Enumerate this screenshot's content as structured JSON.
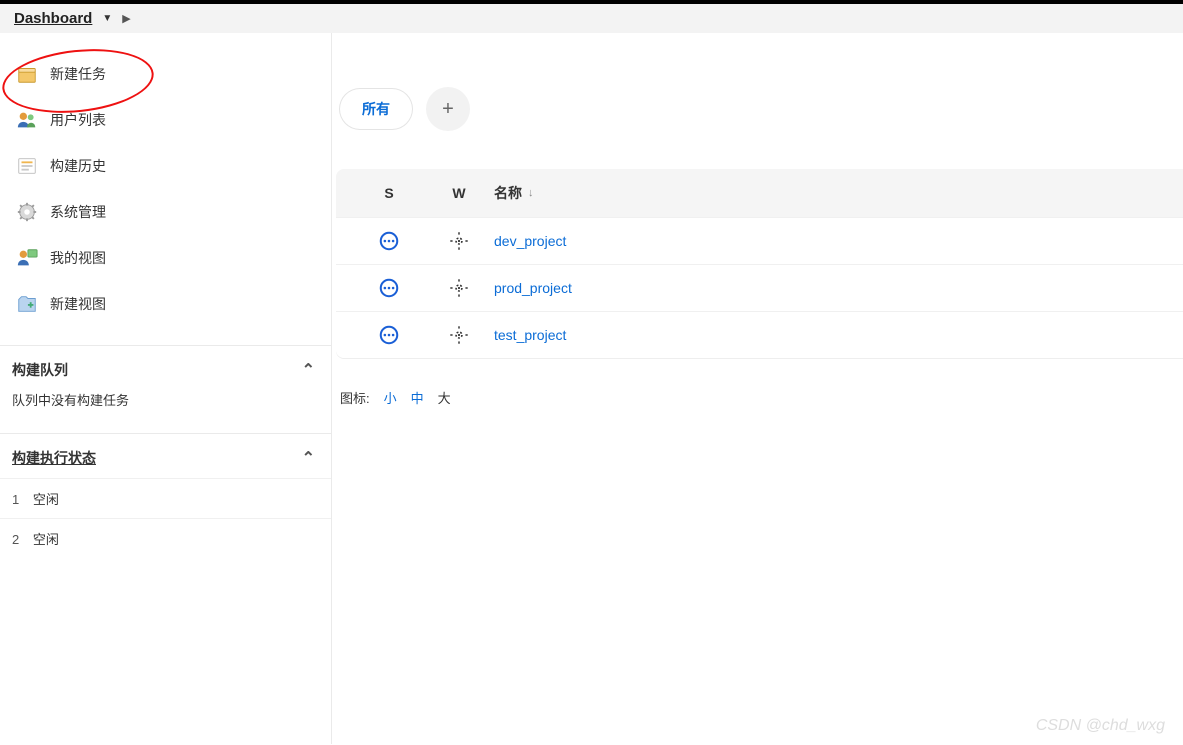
{
  "breadcrumb": {
    "title": "Dashboard"
  },
  "sidebar": {
    "items": [
      {
        "label": "新建任务",
        "icon": "box-icon"
      },
      {
        "label": "用户列表",
        "icon": "users-icon"
      },
      {
        "label": "构建历史",
        "icon": "history-icon"
      },
      {
        "label": "系统管理",
        "icon": "gear-icon"
      },
      {
        "label": "我的视图",
        "icon": "myview-icon"
      },
      {
        "label": "新建视图",
        "icon": "newview-icon"
      }
    ]
  },
  "buildQueue": {
    "title": "构建队列",
    "empty": "队列中没有构建任务"
  },
  "executors": {
    "title": "构建执行状态",
    "items": [
      {
        "num": "1",
        "state": "空闲"
      },
      {
        "num": "2",
        "state": "空闲"
      }
    ]
  },
  "tabs": {
    "active": "所有"
  },
  "table": {
    "headers": {
      "s": "S",
      "w": "W",
      "name": "名称"
    },
    "rows": [
      {
        "name": "dev_project"
      },
      {
        "name": "prod_project"
      },
      {
        "name": "test_project"
      }
    ]
  },
  "legend": {
    "label": "图标:",
    "small": "小",
    "medium": "中",
    "large": "大"
  },
  "watermark": "CSDN @chd_wxg"
}
